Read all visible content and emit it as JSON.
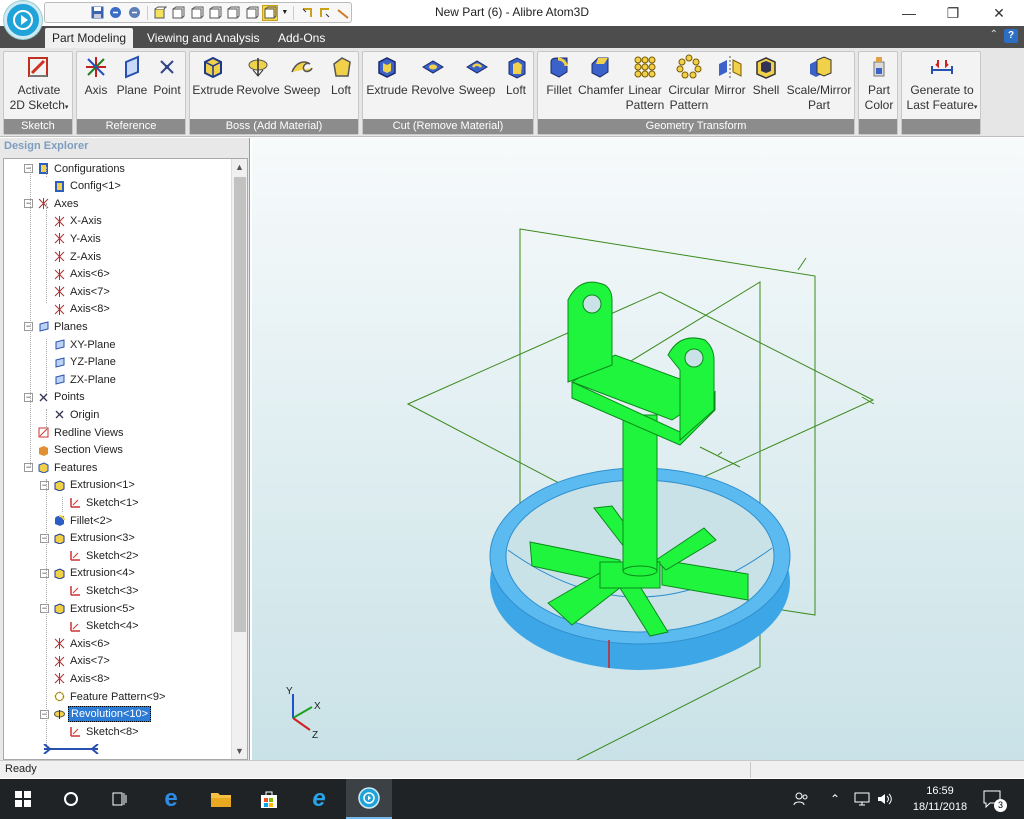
{
  "window": {
    "title": "New Part (6) - Alibre Atom3D",
    "controls": {
      "minimize": "—",
      "maximize": "❐",
      "close": "✕"
    }
  },
  "ribbon_tabs": [
    {
      "label": "Part Modeling",
      "active": true
    },
    {
      "label": "Viewing and Analysis",
      "active": false
    },
    {
      "label": "Add-Ons",
      "active": false
    }
  ],
  "ribbon": {
    "sketch": {
      "label": "Sketch",
      "activate_line1": "Activate",
      "activate_line2": "2D Sketch"
    },
    "reference": {
      "label": "Reference",
      "axis": "Axis",
      "plane": "Plane",
      "point": "Point"
    },
    "boss": {
      "label": "Boss (Add Material)",
      "extrude": "Extrude",
      "revolve": "Revolve",
      "sweep": "Sweep",
      "loft": "Loft"
    },
    "cut": {
      "label": "Cut (Remove Material)",
      "extrude": "Extrude",
      "revolve": "Revolve",
      "sweep": "Sweep",
      "loft": "Loft"
    },
    "geometry": {
      "label": "Geometry Transform",
      "fillet": "Fillet",
      "chamfer": "Chamfer",
      "linear1": "Linear",
      "linear2": "Pattern",
      "circular1": "Circular",
      "circular2": "Pattern",
      "mirror": "Mirror",
      "shell": "Shell",
      "scale1": "Scale/Mirror",
      "scale2": "Part"
    },
    "part_color": {
      "line1": "Part",
      "line2": "Color"
    },
    "generate": {
      "line1": "Generate to",
      "line2": "Last Feature"
    }
  },
  "explorer": {
    "title": "Design Explorer",
    "nodes": [
      {
        "label": "Configurations",
        "icon": "config-icon"
      },
      {
        "label": "Config<1>",
        "icon": "config-icon"
      },
      {
        "label": "Axes",
        "icon": "axis-icon"
      },
      {
        "label": "X-Axis",
        "icon": "axis-icon"
      },
      {
        "label": "Y-Axis",
        "icon": "axis-icon"
      },
      {
        "label": "Z-Axis",
        "icon": "axis-icon"
      },
      {
        "label": "Axis<6>",
        "icon": "axis-icon"
      },
      {
        "label": "Axis<7>",
        "icon": "axis-icon"
      },
      {
        "label": "Axis<8>",
        "icon": "axis-icon"
      },
      {
        "label": "Planes",
        "icon": "plane-icon"
      },
      {
        "label": "XY-Plane",
        "icon": "plane-icon"
      },
      {
        "label": "YZ-Plane",
        "icon": "plane-icon"
      },
      {
        "label": "ZX-Plane",
        "icon": "plane-icon"
      },
      {
        "label": "Points",
        "icon": "point-icon"
      },
      {
        "label": "Origin",
        "icon": "point-icon"
      },
      {
        "label": "Redline Views",
        "icon": "redline-icon"
      },
      {
        "label": "Section Views",
        "icon": "section-icon"
      },
      {
        "label": "Features",
        "icon": "features-icon"
      },
      {
        "label": "Extrusion<1>",
        "icon": "extrusion-icon"
      },
      {
        "label": "Sketch<1>",
        "icon": "sketch-icon"
      },
      {
        "label": "Fillet<2>",
        "icon": "fillet-icon"
      },
      {
        "label": "Extrusion<3>",
        "icon": "extrusion-icon"
      },
      {
        "label": "Sketch<2>",
        "icon": "sketch-icon"
      },
      {
        "label": "Extrusion<4>",
        "icon": "extrusion-icon"
      },
      {
        "label": "Sketch<3>",
        "icon": "sketch-icon"
      },
      {
        "label": "Extrusion<5>",
        "icon": "extrusion-icon"
      },
      {
        "label": "Sketch<4>",
        "icon": "sketch-icon"
      },
      {
        "label": "Axis<6>",
        "icon": "axis-icon"
      },
      {
        "label": "Axis<7>",
        "icon": "axis-icon"
      },
      {
        "label": "Axis<8>",
        "icon": "axis-icon"
      },
      {
        "label": "Feature Pattern<9>",
        "icon": "pattern-icon"
      },
      {
        "label": "Revolution<10>",
        "icon": "revolve-icon"
      },
      {
        "label": "Sketch<8>",
        "icon": "sketch-icon"
      }
    ]
  },
  "viewport": {
    "triad": {
      "y": "Y",
      "x": "X",
      "z": "Z"
    },
    "colors": {
      "part": "#1ef53c",
      "ring": "#3da6e6",
      "reference": "#3b8a1e"
    }
  },
  "status": {
    "text": "Ready"
  },
  "taskbar": {
    "time": "16:59",
    "date": "18/11/2018",
    "notifications": "3"
  }
}
